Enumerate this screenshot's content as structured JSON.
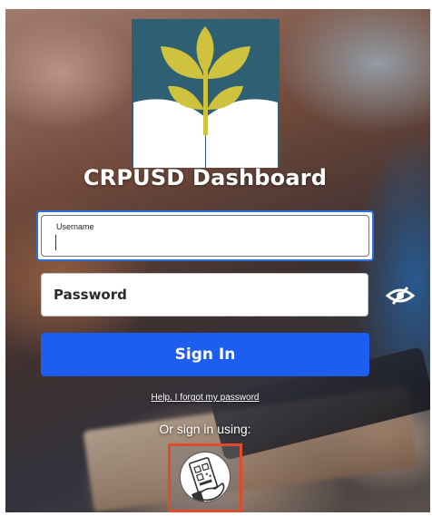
{
  "app": {
    "title": "CRPUSD Dashboard"
  },
  "colors": {
    "primary_button": "#1d5ef0",
    "focus_ring": "#2b6fe6",
    "highlight_box": "#e14b2a",
    "logo_background": "#2f5f73",
    "logo_leaves": "#cfc23e"
  },
  "logo": {
    "icon": "sprout-on-book-logo"
  },
  "form": {
    "username": {
      "label": "Username",
      "value": ""
    },
    "password": {
      "placeholder": "Password",
      "toggle_icon": "eye-slash-icon"
    },
    "sign_in_label": "Sign In",
    "forgot_link": "Help, I forgot my password"
  },
  "alternate_sign_in": {
    "label": "Or sign in using:",
    "option_icon": "qr-code-badge-icon"
  }
}
